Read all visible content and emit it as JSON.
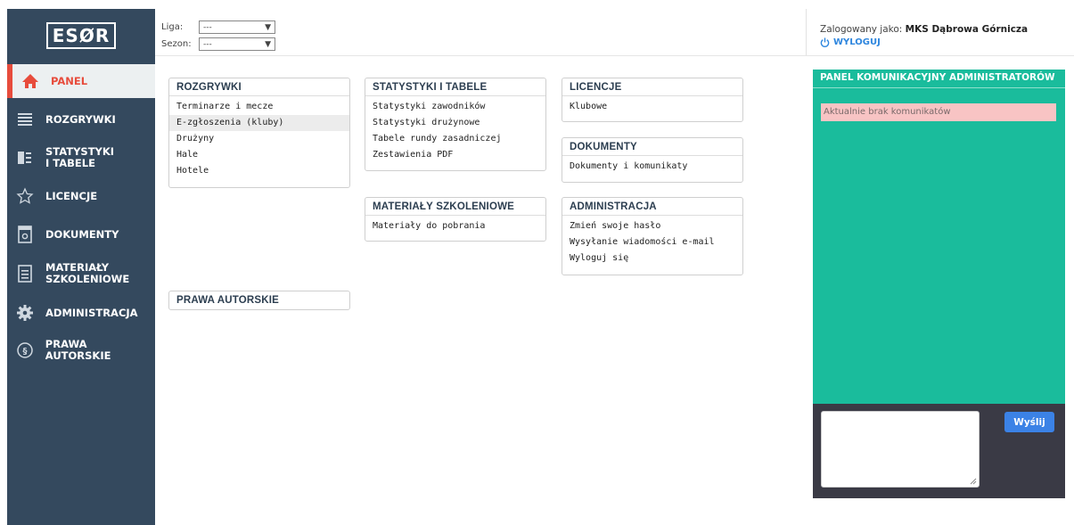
{
  "logo": "ESØR",
  "header": {
    "liga_label": "Liga:",
    "liga_value": "---",
    "sezon_label": "Sezon:",
    "sezon_value": "---",
    "login_prefix": "Zalogowany jako:",
    "login_name": "MKS Dąbrowa Górnicza",
    "logout_label": "WYLOGUJ"
  },
  "sidebar": {
    "items": [
      {
        "label": "PANEL",
        "icon": "home-icon",
        "active": true
      },
      {
        "label": "ROZGRYWKI",
        "icon": "list-icon"
      },
      {
        "label": "STATYSTYKI I TABELE",
        "icon": "stats-icon"
      },
      {
        "label": "LICENCJE",
        "icon": "star-icon"
      },
      {
        "label": "DOKUMENTY",
        "icon": "document-icon"
      },
      {
        "label": "MATERIAŁY SZKOLENIOWE",
        "icon": "training-icon"
      },
      {
        "label": "ADMINISTRACJA",
        "icon": "gear-icon"
      },
      {
        "label": "PRAWA AUTORSKIE",
        "icon": "copyright-icon"
      }
    ]
  },
  "boxes": {
    "rozgrywki": {
      "title": "ROZGRYWKI",
      "items": [
        "Terminarze i mecze",
        "E-zgłoszenia (kluby)",
        "Drużyny",
        "Hale",
        "Hotele"
      ]
    },
    "statystyki": {
      "title": "STATYSTYKI I TABELE",
      "items": [
        "Statystyki zawodników",
        "Statystyki drużynowe",
        "Tabele rundy zasadniczej",
        "Zestawienia PDF"
      ]
    },
    "licencje": {
      "title": "LICENCJE",
      "items": [
        "Klubowe"
      ]
    },
    "dokumenty": {
      "title": "DOKUMENTY",
      "items": [
        "Dokumenty i komunikaty"
      ]
    },
    "materialy": {
      "title": "MATERIAŁY SZKOLENIOWE",
      "items": [
        "Materiały do pobrania"
      ]
    },
    "administracja": {
      "title": "ADMINISTRACJA",
      "items": [
        "Zmień swoje hasło",
        "Wysyłanie wiadomości e-mail",
        "Wyloguj się"
      ]
    },
    "prawa": {
      "title": "PRAWA AUTORSKIE"
    }
  },
  "comm_panel": {
    "title": "PANEL KOMUNIKACYJNY ADMINISTRATORÓW",
    "message": "Aktualnie brak komunikatów",
    "send_label": "Wyślij"
  },
  "colors": {
    "sidebar": "#34495e",
    "active": "#e74c3c",
    "panel": "#1abc9c",
    "send": "#3b82e6"
  }
}
